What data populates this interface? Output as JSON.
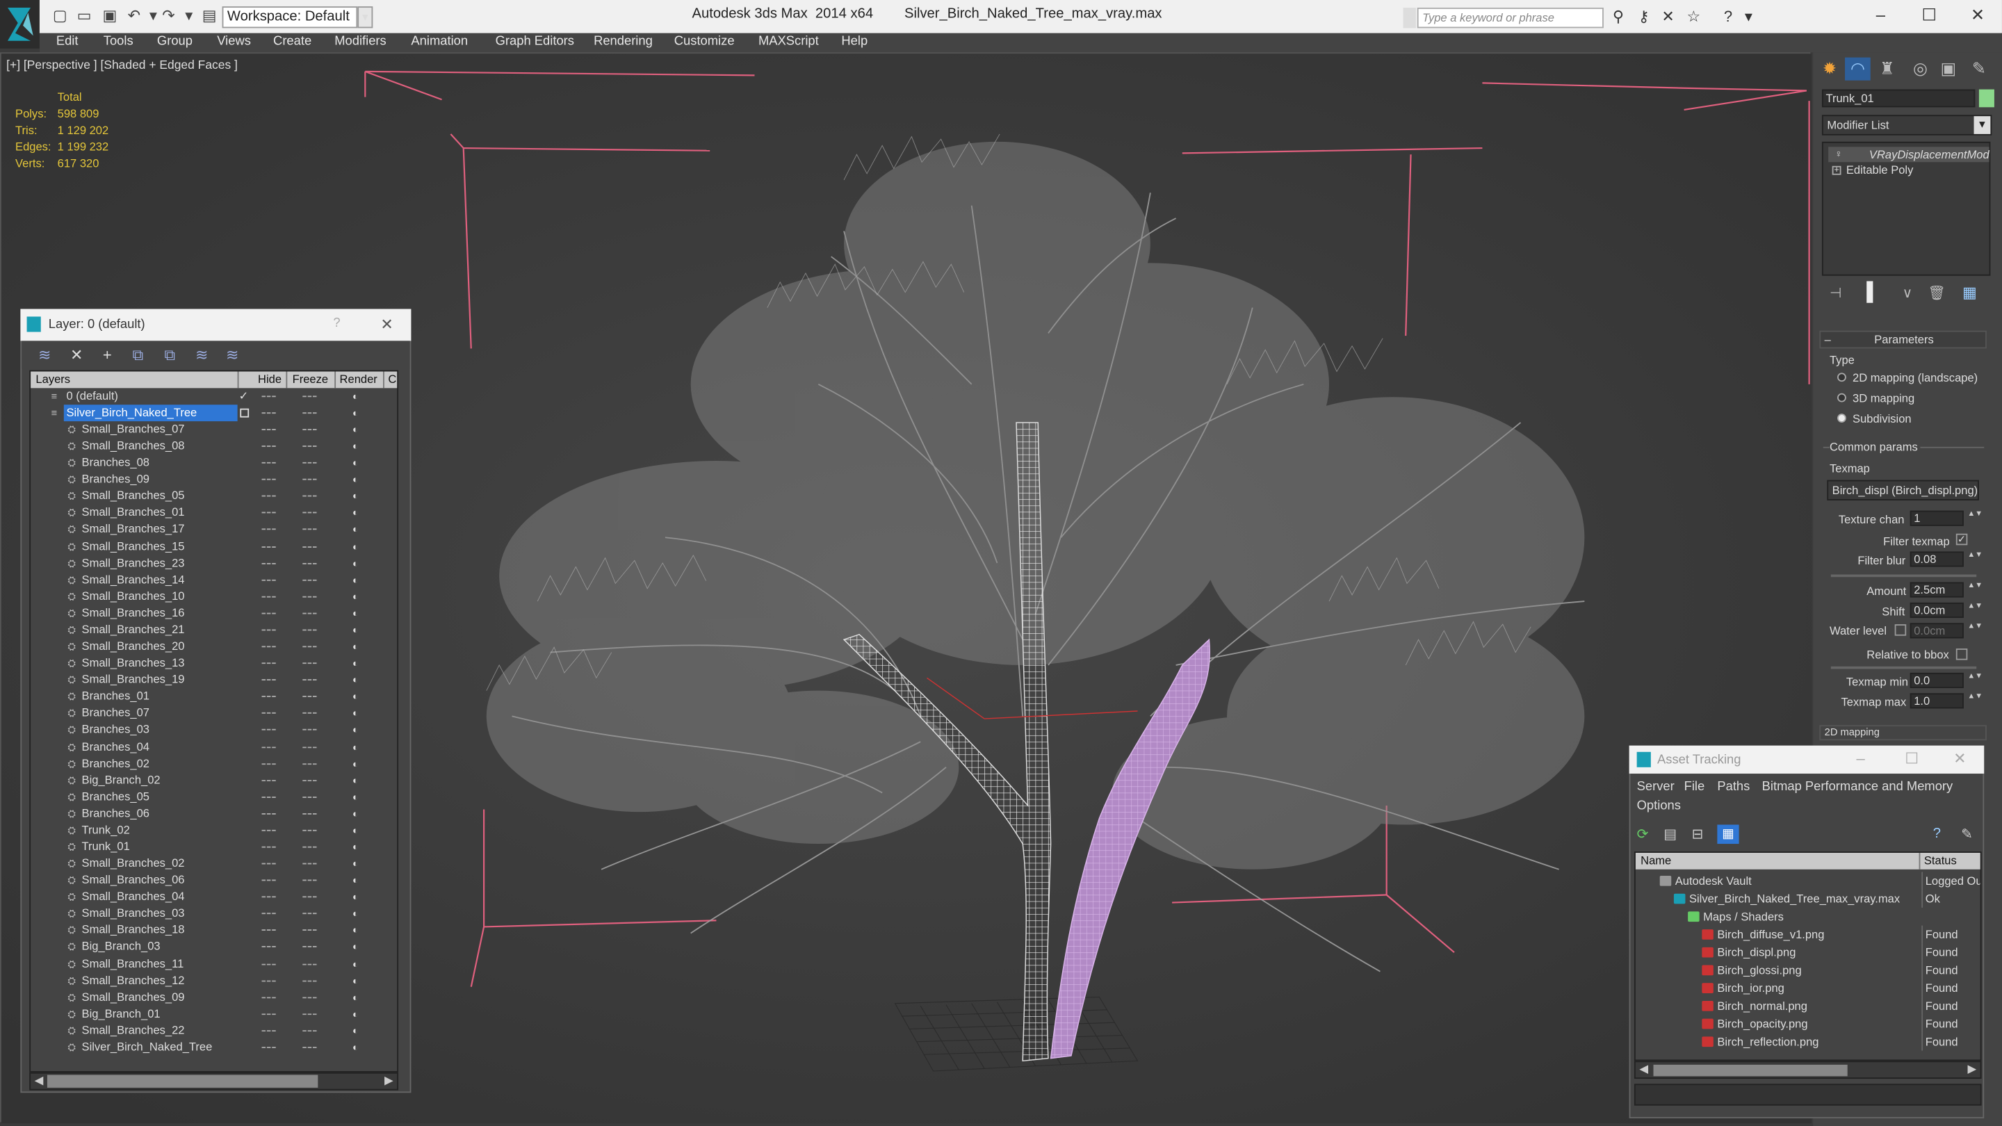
{
  "window": {
    "app_title": "Autodesk 3ds Max  2014 x64",
    "file_title": "Silver_Birch_Naked_Tree_max_vray.max",
    "workspace": "Workspace: Default",
    "search_placeholder": "Type a keyword or phrase"
  },
  "menu": [
    "Edit",
    "Tools",
    "Group",
    "Views",
    "Create",
    "Modifiers",
    "Animation",
    "Graph Editors",
    "Rendering",
    "Customize",
    "MAXScript",
    "Help"
  ],
  "viewport": {
    "label": "[+] [Perspective ] [Shaded + Edged Faces ]",
    "stats": {
      "header": "Total",
      "rows": [
        {
          "label": "Polys:",
          "value": "598 809"
        },
        {
          "label": "Tris:",
          "value": "1 129 202"
        },
        {
          "label": "Edges:",
          "value": "1 199 232"
        },
        {
          "label": "Verts:",
          "value": "617 320"
        }
      ]
    }
  },
  "layer_window": {
    "title": "Layer: 0 (default)",
    "help": "?",
    "columns": {
      "layers": "Layers",
      "hide": "Hide",
      "freeze": "Freeze",
      "render": "Render",
      "extra": "C"
    },
    "layers": [
      {
        "name": "0 (default)",
        "level": "top",
        "check": "✓"
      },
      {
        "name": "Silver_Birch_Naked_Tree",
        "level": "top",
        "selected": true
      }
    ],
    "objects": [
      "Small_Branches_07",
      "Small_Branches_08",
      "Branches_08",
      "Branches_09",
      "Small_Branches_05",
      "Small_Branches_01",
      "Small_Branches_17",
      "Small_Branches_15",
      "Small_Branches_23",
      "Small_Branches_14",
      "Small_Branches_10",
      "Small_Branches_16",
      "Small_Branches_21",
      "Small_Branches_20",
      "Small_Branches_13",
      "Small_Branches_19",
      "Branches_01",
      "Branches_07",
      "Branches_03",
      "Branches_04",
      "Branches_02",
      "Big_Branch_02",
      "Branches_05",
      "Branches_06",
      "Trunk_02",
      "Trunk_01",
      "Small_Branches_02",
      "Small_Branches_06",
      "Small_Branches_04",
      "Small_Branches_03",
      "Small_Branches_18",
      "Big_Branch_03",
      "Small_Branches_11",
      "Small_Branches_12",
      "Small_Branches_09",
      "Big_Branch_01",
      "Small_Branches_22",
      "Silver_Birch_Naked_Tree"
    ]
  },
  "command_panel": {
    "object_name": "Trunk_01",
    "object_color": "#8bd88b",
    "modifier_list": "Modifier List",
    "stack": [
      "VRayDisplacementMod",
      "Editable Poly"
    ],
    "parameters": {
      "rollout_title": "Parameters",
      "type_label": "Type",
      "types": [
        "2D mapping (landscape)",
        "3D mapping",
        "Subdivision"
      ],
      "selected_type": "Subdivision",
      "common_params": "Common params",
      "texmap_label": "Texmap",
      "texmap_value": "Birch_displ (Birch_displ.png)",
      "texture_chan_label": "Texture chan",
      "texture_chan": "1",
      "filter_texmap_label": "Filter texmap",
      "filter_blur_label": "Filter blur",
      "filter_blur": "0.08",
      "amount_label": "Amount",
      "amount": "2.5cm",
      "shift_label": "Shift",
      "shift": "0.0cm",
      "water_level_label": "Water level",
      "water_level": "0.0cm",
      "relative_bbox_label": "Relative to bbox",
      "texmap_min_label": "Texmap min",
      "texmap_min": "0.0",
      "texmap_max_label": "Texmap max",
      "texmap_max": "1.0",
      "next_rollout": "2D mapping"
    }
  },
  "asset_tracking": {
    "title": "Asset Tracking",
    "menu": [
      "Server",
      "File",
      "Paths",
      "Bitmap Performance and Memory",
      "Options"
    ],
    "columns": {
      "name": "Name",
      "status": "Status"
    },
    "rows": [
      {
        "name": "Autodesk Vault",
        "status": "Logged Out",
        "indent": 1,
        "icon": "vault-icon"
      },
      {
        "name": "Silver_Birch_Naked_Tree_max_vray.max",
        "status": "Ok",
        "indent": 2,
        "icon": "max-file-icon"
      },
      {
        "name": "Maps / Shaders",
        "status": "",
        "indent": 3,
        "icon": "maps-folder-icon"
      },
      {
        "name": "Birch_diffuse_v1.png",
        "status": "Found",
        "indent": 4,
        "icon": "png-file-icon"
      },
      {
        "name": "Birch_displ.png",
        "status": "Found",
        "indent": 4,
        "icon": "png-file-icon"
      },
      {
        "name": "Birch_glossi.png",
        "status": "Found",
        "indent": 4,
        "icon": "png-file-icon"
      },
      {
        "name": "Birch_ior.png",
        "status": "Found",
        "indent": 4,
        "icon": "png-file-icon"
      },
      {
        "name": "Birch_normal.png",
        "status": "Found",
        "indent": 4,
        "icon": "png-file-icon"
      },
      {
        "name": "Birch_opacity.png",
        "status": "Found",
        "indent": 4,
        "icon": "png-file-icon"
      },
      {
        "name": "Birch_reflection.png",
        "status": "Found",
        "indent": 4,
        "icon": "png-file-icon"
      }
    ]
  },
  "colors": {
    "selection": "#2f77d5",
    "stats_text": "#e4c63a",
    "bbox_lines": "#e0607e",
    "trunk_selected": "#c29ad8"
  }
}
